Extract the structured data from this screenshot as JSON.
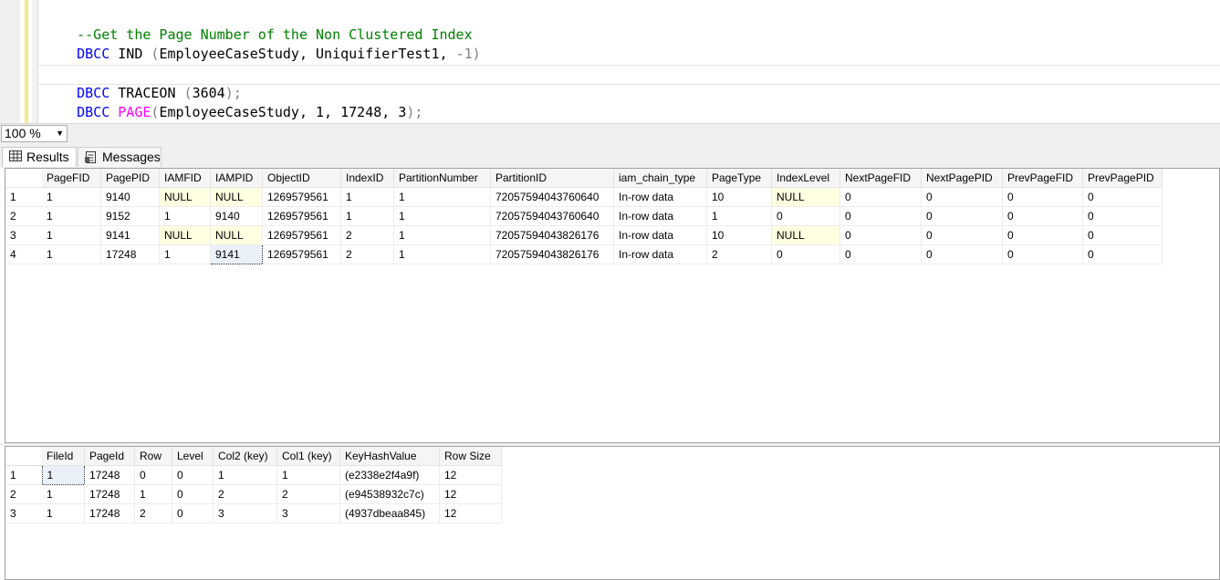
{
  "editor": {
    "line1": "--Get the Page Number of the Non Clustered Index",
    "line2": {
      "kw": "DBCC",
      "fn": "IND",
      "open": "(",
      "args": "EmployeeCaseStudy, UniquifierTest1, ",
      "neg": "-1",
      "close": ")"
    },
    "line4": {
      "kw": "DBCC",
      "fn": "TRACEON",
      "open": "(",
      "arg": "3604",
      "close": ");"
    },
    "line5": {
      "kw": "DBCC",
      "fn": "PAGE",
      "open": "(",
      "args": "EmployeeCaseStudy, 1, 17248, 3",
      "close": ");"
    }
  },
  "toolbar": {
    "zoom": "100 %"
  },
  "tabs": {
    "results": "Results",
    "messages": "Messages"
  },
  "grid1": {
    "columns": [
      "PageFID",
      "PagePID",
      "IAMFID",
      "IAMPID",
      "ObjectID",
      "IndexID",
      "PartitionNumber",
      "PartitionID",
      "iam_chain_type",
      "PageType",
      "IndexLevel",
      "NextPageFID",
      "NextPagePID",
      "PrevPageFID",
      "PrevPagePID"
    ],
    "rows": [
      [
        "1",
        "9140",
        "NULL",
        "NULL",
        "1269579561",
        "1",
        "1",
        "72057594043760640",
        "In-row data",
        "10",
        "NULL",
        "0",
        "0",
        "0",
        "0"
      ],
      [
        "1",
        "9152",
        "1",
        "9140",
        "1269579561",
        "1",
        "1",
        "72057594043760640",
        "In-row data",
        "1",
        "0",
        "0",
        "0",
        "0",
        "0"
      ],
      [
        "1",
        "9141",
        "NULL",
        "NULL",
        "1269579561",
        "2",
        "1",
        "72057594043826176",
        "In-row data",
        "10",
        "NULL",
        "0",
        "0",
        "0",
        "0"
      ],
      [
        "1",
        "17248",
        "1",
        "9141",
        "1269579561",
        "2",
        "1",
        "72057594043826176",
        "In-row data",
        "2",
        "0",
        "0",
        "0",
        "0",
        "0"
      ]
    ],
    "row_numbers": [
      "1",
      "2",
      "3",
      "4"
    ]
  },
  "grid2": {
    "columns": [
      "FileId",
      "PageId",
      "Row",
      "Level",
      "Col2 (key)",
      "Col1 (key)",
      "KeyHashValue",
      "Row Size"
    ],
    "rows": [
      [
        "1",
        "17248",
        "0",
        "0",
        "1",
        "1",
        "(e2338e2f4a9f)",
        "12"
      ],
      [
        "1",
        "17248",
        "1",
        "0",
        "2",
        "2",
        "(e94538932c7c)",
        "12"
      ],
      [
        "1",
        "17248",
        "2",
        "0",
        "3",
        "3",
        "(4937dbeaa845)",
        "12"
      ]
    ],
    "row_numbers": [
      "1",
      "2",
      "3"
    ]
  }
}
